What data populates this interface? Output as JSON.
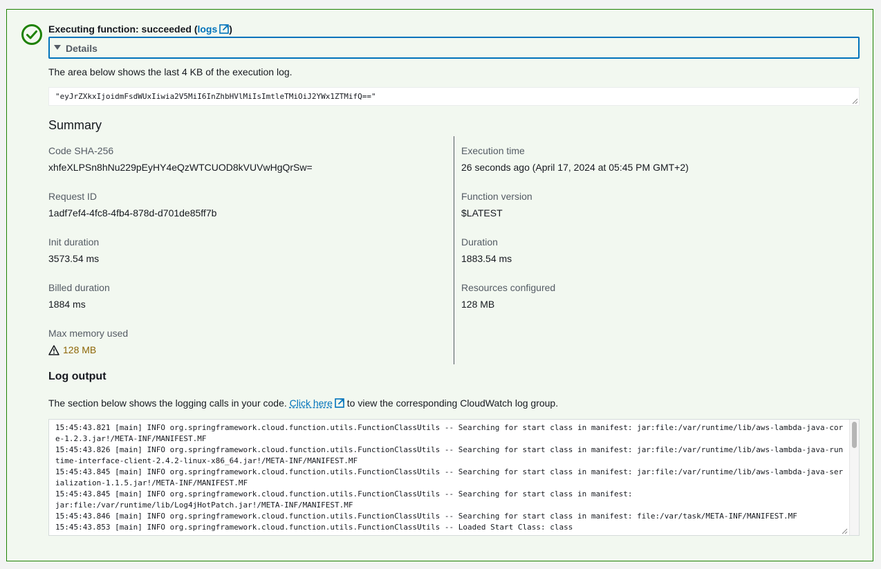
{
  "status": {
    "prefix": "Executing function: succeeded (",
    "logs_link": "logs",
    "suffix": ")"
  },
  "details": {
    "label": "Details"
  },
  "log_note": "The area below shows the last 4 KB of the execution log.",
  "result_value": "\"eyJrZXkxIjoidmFsdWUxIiwia2V5MiI6InZhbHVlMiIsImtleTMiOiJ2YWx1ZTMifQ==\"",
  "summary": {
    "title": "Summary",
    "left": [
      {
        "label": "Code SHA-256",
        "value": "xhfeXLPSn8hNu229pEyHY4eQzWTCUOD8kVUVwHgQrSw="
      },
      {
        "label": "Request ID",
        "value": "1adf7ef4-4fc8-4fb4-878d-d701de85ff7b"
      },
      {
        "label": "Init duration",
        "value": "3573.54 ms"
      },
      {
        "label": "Billed duration",
        "value": "1884 ms"
      },
      {
        "label": "Max memory used",
        "value": "128 MB"
      }
    ],
    "right": [
      {
        "label": "Execution time",
        "value": "26 seconds ago (April 17, 2024 at 05:45 PM GMT+2)"
      },
      {
        "label": "Function version",
        "value": "$LATEST"
      },
      {
        "label": "Duration",
        "value": "1883.54 ms"
      },
      {
        "label": "Resources configured",
        "value": "128 MB"
      }
    ]
  },
  "log_output": {
    "title": "Log output",
    "desc_prefix": "The section below shows the logging calls in your code.",
    "link_text": "Click here",
    "desc_suffix": "to view the corresponding CloudWatch log group.",
    "lines": "15:45:43.821 [main] INFO org.springframework.cloud.function.utils.FunctionClassUtils -- Searching for start class in manifest: jar:file:/var/runtime/lib/aws-lambda-java-core-1.2.3.jar!/META-INF/MANIFEST.MF\n15:45:43.826 [main] INFO org.springframework.cloud.function.utils.FunctionClassUtils -- Searching for start class in manifest: jar:file:/var/runtime/lib/aws-lambda-java-runtime-interface-client-2.4.2-linux-x86_64.jar!/META-INF/MANIFEST.MF\n15:45:43.845 [main] INFO org.springframework.cloud.function.utils.FunctionClassUtils -- Searching for start class in manifest: jar:file:/var/runtime/lib/aws-lambda-java-serialization-1.1.5.jar!/META-INF/MANIFEST.MF\n15:45:43.845 [main] INFO org.springframework.cloud.function.utils.FunctionClassUtils -- Searching for start class in manifest:\njar:file:/var/runtime/lib/Log4jHotPatch.jar!/META-INF/MANIFEST.MF\n15:45:43.846 [main] INFO org.springframework.cloud.function.utils.FunctionClassUtils -- Searching for start class in manifest: file:/var/task/META-INF/MANIFEST.MF\n15:45:43.853 [main] INFO org.springframework.cloud.function.utils.FunctionClassUtils -- Loaded Start Class: class"
  },
  "colors": {
    "success": "#1d8102",
    "link": "#0073bb",
    "warning": "#8d6605"
  },
  "icons": {
    "status": "success-check-circle-icon",
    "external": "external-link-icon",
    "caret": "caret-down-icon",
    "warning": "warning-triangle-icon"
  }
}
